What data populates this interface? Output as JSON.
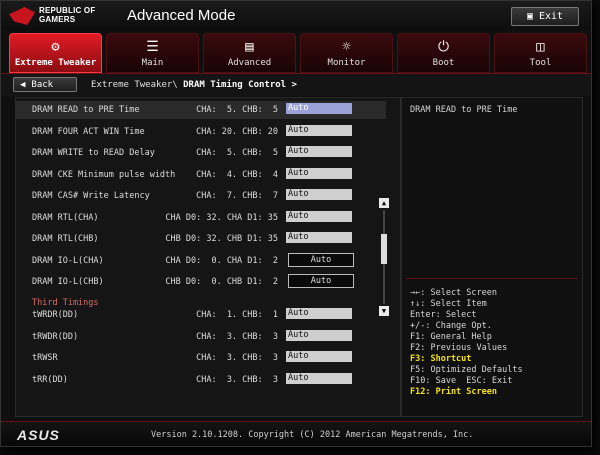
{
  "header": {
    "logo_text_line1": "REPUBLIC OF",
    "logo_text_line2": "GAMERS",
    "mode_title": "Advanced Mode",
    "exit_label": "Exit"
  },
  "tabs": [
    {
      "label": "Extreme Tweaker",
      "icon": "tweaker-icon",
      "active": true
    },
    {
      "label": "Main",
      "icon": "list-icon",
      "active": false
    },
    {
      "label": "Advanced",
      "icon": "advanced-icon",
      "active": false
    },
    {
      "label": "Monitor",
      "icon": "monitor-icon",
      "active": false
    },
    {
      "label": "Boot",
      "icon": "power-icon",
      "active": false
    },
    {
      "label": "Tool",
      "icon": "tool-icon",
      "active": false
    }
  ],
  "nav": {
    "back_label": "Back",
    "breadcrumb_parent": "Extreme Tweaker\\",
    "breadcrumb_current": "DRAM Timing Control >"
  },
  "rows": [
    {
      "name": "DRAM READ to PRE Time",
      "vals": "CHA:  5. CHB:  5",
      "value": "Auto",
      "selected": true
    },
    {
      "name": "DRAM FOUR ACT WIN Time",
      "vals": "CHA: 20. CHB: 20",
      "value": "Auto"
    },
    {
      "name": "DRAM WRITE to READ Delay",
      "vals": "CHA:  5. CHB:  5",
      "value": "Auto"
    },
    {
      "name": "DRAM CKE Minimum pulse width",
      "vals": "CHA:  4. CHB:  4",
      "value": "Auto"
    },
    {
      "name": "DRAM CAS# Write Latency",
      "vals": "CHA:  7. CHB:  7",
      "value": "Auto"
    },
    {
      "name": "DRAM RTL(CHA)",
      "vals": "CHA D0: 32. CHA D1: 35",
      "value": "Auto"
    },
    {
      "name": "DRAM RTL(CHB)",
      "vals": "CHB D0: 32. CHB D1: 35",
      "value": "Auto"
    },
    {
      "name": "DRAM IO-L(CHA)",
      "vals": "CHA D0:  0. CHA D1:  2",
      "value": "Auto",
      "dark": true
    },
    {
      "name": "DRAM IO-L(CHB)",
      "vals": "CHB D0:  0. CHB D1:  2",
      "value": "Auto",
      "dark": true
    }
  ],
  "section_title": "Third Timings",
  "third_rows": [
    {
      "name": "tWRDR(DD)",
      "vals": "CHA:  1. CHB:  1",
      "value": "Auto"
    },
    {
      "name": "tRWDR(DD)",
      "vals": "CHA:  3. CHB:  3",
      "value": "Auto"
    },
    {
      "name": "tRWSR",
      "vals": "CHA:  3. CHB:  3",
      "value": "Auto"
    },
    {
      "name": "tRR(DD)",
      "vals": "CHA:  3. CHB:  3",
      "value": "Auto"
    }
  ],
  "help": {
    "description": "DRAM READ to PRE Time",
    "keys": [
      {
        "text": "→←: Select Screen",
        "highlight": false
      },
      {
        "text": "↑↓: Select Item",
        "highlight": false
      },
      {
        "text": "Enter: Select",
        "highlight": false
      },
      {
        "text": "+/-: Change Opt.",
        "highlight": false
      },
      {
        "text": "F1: General Help",
        "highlight": false
      },
      {
        "text": "F2: Previous Values",
        "highlight": false
      },
      {
        "text": "F3: Shortcut",
        "highlight": true
      },
      {
        "text": "F5: Optimized Defaults",
        "highlight": false
      },
      {
        "text": "F10: Save  ESC: Exit",
        "highlight": false
      },
      {
        "text": "F12: Print Screen",
        "highlight": true
      }
    ]
  },
  "footer": {
    "brand": "ASUS",
    "version": "Version 2.10.1208. Copyright (C) 2012 American Megatrends, Inc."
  },
  "colors": {
    "accent_red": "#e21b24",
    "highlight_yellow": "#f2e21b",
    "selected_field": "#9aa2d8"
  }
}
